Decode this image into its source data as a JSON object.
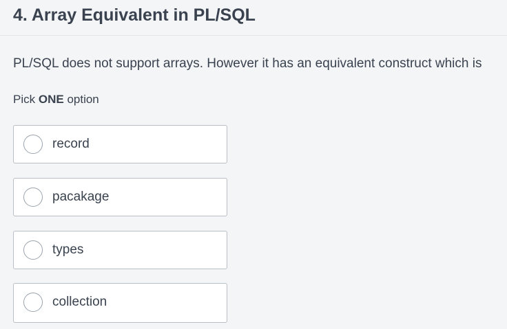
{
  "question": {
    "title": "4. Array Equivalent in PL/SQL",
    "text": "PL/SQL does not support arrays. However it has an equivalent construct which is",
    "instruction_prefix": "Pick",
    "instruction_emphasis": "ONE",
    "instruction_suffix": "option"
  },
  "options": [
    {
      "label": "record"
    },
    {
      "label": "pacakage"
    },
    {
      "label": "types"
    },
    {
      "label": "collection"
    }
  ]
}
